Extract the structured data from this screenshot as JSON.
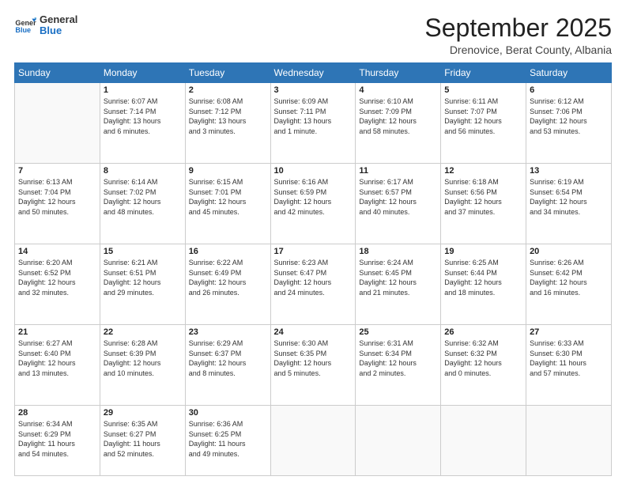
{
  "header": {
    "logo_general": "General",
    "logo_blue": "Blue",
    "title": "September 2025",
    "subtitle": "Drenovice, Berat County, Albania"
  },
  "days_of_week": [
    "Sunday",
    "Monday",
    "Tuesday",
    "Wednesday",
    "Thursday",
    "Friday",
    "Saturday"
  ],
  "weeks": [
    [
      {
        "day": "",
        "text": ""
      },
      {
        "day": "1",
        "text": "Sunrise: 6:07 AM\nSunset: 7:14 PM\nDaylight: 13 hours\nand 6 minutes."
      },
      {
        "day": "2",
        "text": "Sunrise: 6:08 AM\nSunset: 7:12 PM\nDaylight: 13 hours\nand 3 minutes."
      },
      {
        "day": "3",
        "text": "Sunrise: 6:09 AM\nSunset: 7:11 PM\nDaylight: 13 hours\nand 1 minute."
      },
      {
        "day": "4",
        "text": "Sunrise: 6:10 AM\nSunset: 7:09 PM\nDaylight: 12 hours\nand 58 minutes."
      },
      {
        "day": "5",
        "text": "Sunrise: 6:11 AM\nSunset: 7:07 PM\nDaylight: 12 hours\nand 56 minutes."
      },
      {
        "day": "6",
        "text": "Sunrise: 6:12 AM\nSunset: 7:06 PM\nDaylight: 12 hours\nand 53 minutes."
      }
    ],
    [
      {
        "day": "7",
        "text": "Sunrise: 6:13 AM\nSunset: 7:04 PM\nDaylight: 12 hours\nand 50 minutes."
      },
      {
        "day": "8",
        "text": "Sunrise: 6:14 AM\nSunset: 7:02 PM\nDaylight: 12 hours\nand 48 minutes."
      },
      {
        "day": "9",
        "text": "Sunrise: 6:15 AM\nSunset: 7:01 PM\nDaylight: 12 hours\nand 45 minutes."
      },
      {
        "day": "10",
        "text": "Sunrise: 6:16 AM\nSunset: 6:59 PM\nDaylight: 12 hours\nand 42 minutes."
      },
      {
        "day": "11",
        "text": "Sunrise: 6:17 AM\nSunset: 6:57 PM\nDaylight: 12 hours\nand 40 minutes."
      },
      {
        "day": "12",
        "text": "Sunrise: 6:18 AM\nSunset: 6:56 PM\nDaylight: 12 hours\nand 37 minutes."
      },
      {
        "day": "13",
        "text": "Sunrise: 6:19 AM\nSunset: 6:54 PM\nDaylight: 12 hours\nand 34 minutes."
      }
    ],
    [
      {
        "day": "14",
        "text": "Sunrise: 6:20 AM\nSunset: 6:52 PM\nDaylight: 12 hours\nand 32 minutes."
      },
      {
        "day": "15",
        "text": "Sunrise: 6:21 AM\nSunset: 6:51 PM\nDaylight: 12 hours\nand 29 minutes."
      },
      {
        "day": "16",
        "text": "Sunrise: 6:22 AM\nSunset: 6:49 PM\nDaylight: 12 hours\nand 26 minutes."
      },
      {
        "day": "17",
        "text": "Sunrise: 6:23 AM\nSunset: 6:47 PM\nDaylight: 12 hours\nand 24 minutes."
      },
      {
        "day": "18",
        "text": "Sunrise: 6:24 AM\nSunset: 6:45 PM\nDaylight: 12 hours\nand 21 minutes."
      },
      {
        "day": "19",
        "text": "Sunrise: 6:25 AM\nSunset: 6:44 PM\nDaylight: 12 hours\nand 18 minutes."
      },
      {
        "day": "20",
        "text": "Sunrise: 6:26 AM\nSunset: 6:42 PM\nDaylight: 12 hours\nand 16 minutes."
      }
    ],
    [
      {
        "day": "21",
        "text": "Sunrise: 6:27 AM\nSunset: 6:40 PM\nDaylight: 12 hours\nand 13 minutes."
      },
      {
        "day": "22",
        "text": "Sunrise: 6:28 AM\nSunset: 6:39 PM\nDaylight: 12 hours\nand 10 minutes."
      },
      {
        "day": "23",
        "text": "Sunrise: 6:29 AM\nSunset: 6:37 PM\nDaylight: 12 hours\nand 8 minutes."
      },
      {
        "day": "24",
        "text": "Sunrise: 6:30 AM\nSunset: 6:35 PM\nDaylight: 12 hours\nand 5 minutes."
      },
      {
        "day": "25",
        "text": "Sunrise: 6:31 AM\nSunset: 6:34 PM\nDaylight: 12 hours\nand 2 minutes."
      },
      {
        "day": "26",
        "text": "Sunrise: 6:32 AM\nSunset: 6:32 PM\nDaylight: 12 hours\nand 0 minutes."
      },
      {
        "day": "27",
        "text": "Sunrise: 6:33 AM\nSunset: 6:30 PM\nDaylight: 11 hours\nand 57 minutes."
      }
    ],
    [
      {
        "day": "28",
        "text": "Sunrise: 6:34 AM\nSunset: 6:29 PM\nDaylight: 11 hours\nand 54 minutes."
      },
      {
        "day": "29",
        "text": "Sunrise: 6:35 AM\nSunset: 6:27 PM\nDaylight: 11 hours\nand 52 minutes."
      },
      {
        "day": "30",
        "text": "Sunrise: 6:36 AM\nSunset: 6:25 PM\nDaylight: 11 hours\nand 49 minutes."
      },
      {
        "day": "",
        "text": ""
      },
      {
        "day": "",
        "text": ""
      },
      {
        "day": "",
        "text": ""
      },
      {
        "day": "",
        "text": ""
      }
    ]
  ]
}
